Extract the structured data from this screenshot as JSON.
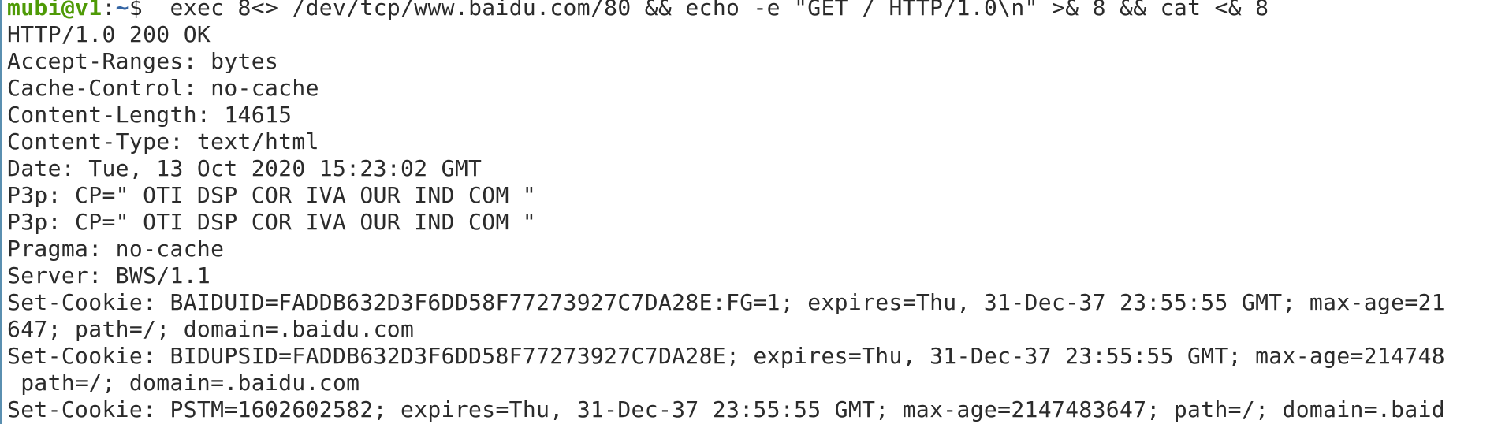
{
  "terminal": {
    "prompt": {
      "user_host": "mubi@v1",
      "separator": ":",
      "path": "~",
      "symbol": "$",
      "colors": {
        "user_host": "#4e9a06",
        "path": "#3465a4",
        "text": "#2b2b2b"
      }
    },
    "command": "  exec 8<> /dev/tcp/www.baidu.com/80 && echo -e \"GET / HTTP/1.0\\n\" >& 8 && cat <& 8",
    "output_lines": [
      "HTTP/1.0 200 OK",
      "Accept-Ranges: bytes",
      "Cache-Control: no-cache",
      "Content-Length: 14615",
      "Content-Type: text/html",
      "Date: Tue, 13 Oct 2020 15:23:02 GMT",
      "P3p: CP=\" OTI DSP COR IVA OUR IND COM \"",
      "P3p: CP=\" OTI DSP COR IVA OUR IND COM \"",
      "Pragma: no-cache",
      "Server: BWS/1.1",
      "Set-Cookie: BAIDUID=FADDB632D3F6DD58F77273927C7DA28E:FG=1; expires=Thu, 31-Dec-37 23:55:55 GMT; max-age=21",
      "647; path=/; domain=.baidu.com",
      "Set-Cookie: BIDUPSID=FADDB632D3F6DD58F77273927C7DA28E; expires=Thu, 31-Dec-37 23:55:55 GMT; max-age=214748",
      " path=/; domain=.baidu.com",
      "Set-Cookie: PSTM=1602602582; expires=Thu, 31-Dec-37 23:55:55 GMT; max-age=2147483647; path=/; domain=.baid"
    ]
  }
}
